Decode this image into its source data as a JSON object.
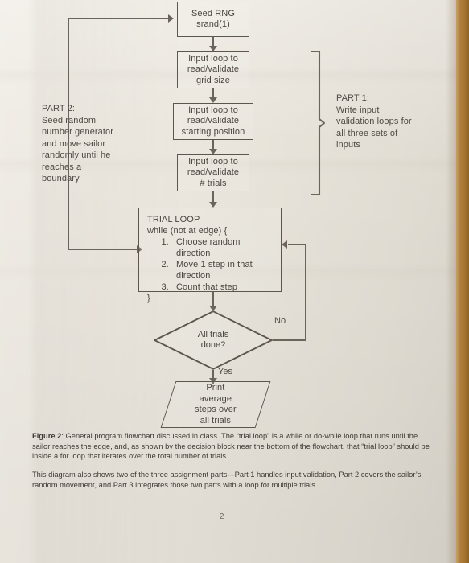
{
  "document": {
    "page_number": "2"
  },
  "flowchart": {
    "nodes": {
      "seed_rng": {
        "line1": "Seed RNG",
        "line2": "srand(1)"
      },
      "input_grid": {
        "line1": "Input loop to",
        "line2": "read/validate",
        "line3": "grid size"
      },
      "input_start": {
        "line1": "Input loop to",
        "line2": "read/validate",
        "line3": "starting position"
      },
      "input_trials": {
        "line1": "Input loop to",
        "line2": "read/validate",
        "line3": "# trials"
      },
      "trial_loop": {
        "title": "TRIAL LOOP",
        "while_line": "while (not at edge) {",
        "steps": [
          "Choose random direction",
          "Move 1 step in that direction",
          "Count that step"
        ],
        "close_brace": "}"
      },
      "decision": {
        "line1": "All trials",
        "line2": "done?"
      },
      "print_result": {
        "line1": "Print",
        "line2": "average",
        "line3": "steps over",
        "line4": "all trials"
      }
    },
    "edge_labels": {
      "no": "No",
      "yes": "Yes"
    },
    "annotations": {
      "part2": {
        "title": "PART 2:",
        "body": "Seed random number generator and move sailor randomly until he reaches a boundary"
      },
      "part1": {
        "title": "PART 1:",
        "body": "Write input validation loops for all three sets of inputs"
      }
    }
  },
  "caption": {
    "label": "Figure 2",
    "separator": ": ",
    "text": "General program flowchart discussed in class. The “trial loop” is a while or do-while loop that runs until the sailor reaches the edge, and, as shown by the decision block near the bottom of the flowchart, that “trial loop” should be inside a for loop that iterates over the total number of trials.",
    "paragraph2": "This diagram also shows two of the three assignment parts—Part 1 handles input validation, Part 2 covers the sailor’s random movement, and Part 3 integrates those two parts with a loop for multiple trials."
  },
  "colors": {
    "paper": "#e9e4da",
    "ink": "#4a453f",
    "line": "#6a645b",
    "scan_edge": "#a5762f"
  }
}
